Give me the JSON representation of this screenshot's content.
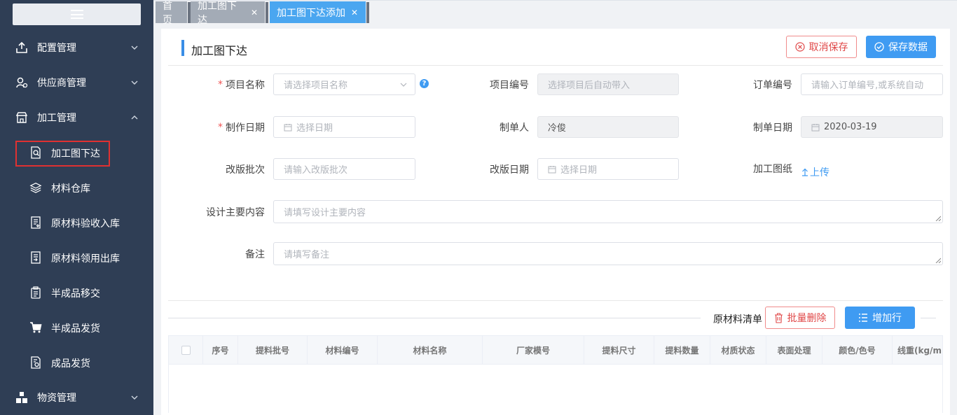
{
  "sidebar": {
    "groups": [
      {
        "label": "配置管理",
        "icon": "upload-box-icon",
        "expanded": false
      },
      {
        "label": "供应商管理",
        "icon": "supplier-icon",
        "expanded": false
      },
      {
        "label": "加工管理",
        "icon": "store-icon",
        "expanded": true
      },
      {
        "label": "物资管理",
        "icon": "boxes-icon",
        "expanded": false
      }
    ],
    "sub_items": [
      {
        "label": "加工图下达",
        "icon": "doc-search-icon",
        "active": true
      },
      {
        "label": "材料仓库",
        "icon": "layers-icon"
      },
      {
        "label": "原材料验收入库",
        "icon": "doc-in-icon"
      },
      {
        "label": "原材料领用出库",
        "icon": "doc-out-icon"
      },
      {
        "label": "半成品移交",
        "icon": "clipboard-icon"
      },
      {
        "label": "半成品发货",
        "icon": "cart-icon"
      },
      {
        "label": "成品发货",
        "icon": "doc-gear-icon"
      }
    ]
  },
  "tabs": [
    {
      "label": "首页",
      "closable": false
    },
    {
      "label": "加工图下达",
      "closable": true
    },
    {
      "label": "加工图下达添加",
      "closable": true,
      "active": true
    }
  ],
  "panel": {
    "title": "加工图下达",
    "cancel_label": "取消保存",
    "save_label": "保存数据"
  },
  "form": {
    "project_name": {
      "label": "项目名称",
      "placeholder": "请选择项目名称",
      "required": true
    },
    "project_no": {
      "label": "项目编号",
      "placeholder": "选择项目后自动带入"
    },
    "order_no": {
      "label": "订单编号",
      "placeholder": "请输入订单编号,或系统自动"
    },
    "make_date": {
      "label": "制作日期",
      "placeholder": "选择日期",
      "required": true
    },
    "maker": {
      "label": "制单人",
      "value": "冷俊"
    },
    "bill_date": {
      "label": "制单日期",
      "value": "2020-03-19"
    },
    "revision": {
      "label": "改版批次",
      "placeholder": "请输入改版批次"
    },
    "revision_date": {
      "label": "改版日期",
      "placeholder": "选择日期"
    },
    "drawing": {
      "label": "加工图纸",
      "upload_label": "上传"
    },
    "design_content": {
      "label": "设计主要内容",
      "placeholder": "请填写设计主要内容"
    },
    "remark": {
      "label": "备注",
      "placeholder": "请填写备注"
    }
  },
  "material_list": {
    "title": "原材料清单",
    "batch_delete_label": "批量删除",
    "add_row_label": "增加行",
    "columns": [
      "序号",
      "提料批号",
      "材料编号",
      "材料名称",
      "厂家模号",
      "提料尺寸",
      "提料数量",
      "材质状态",
      "表面处理",
      "颜色/色号",
      "线重(kg/m"
    ]
  },
  "colors": {
    "sidebar": "#2f3e55",
    "accent": "#3f9bf2",
    "danger": "#e04848"
  }
}
